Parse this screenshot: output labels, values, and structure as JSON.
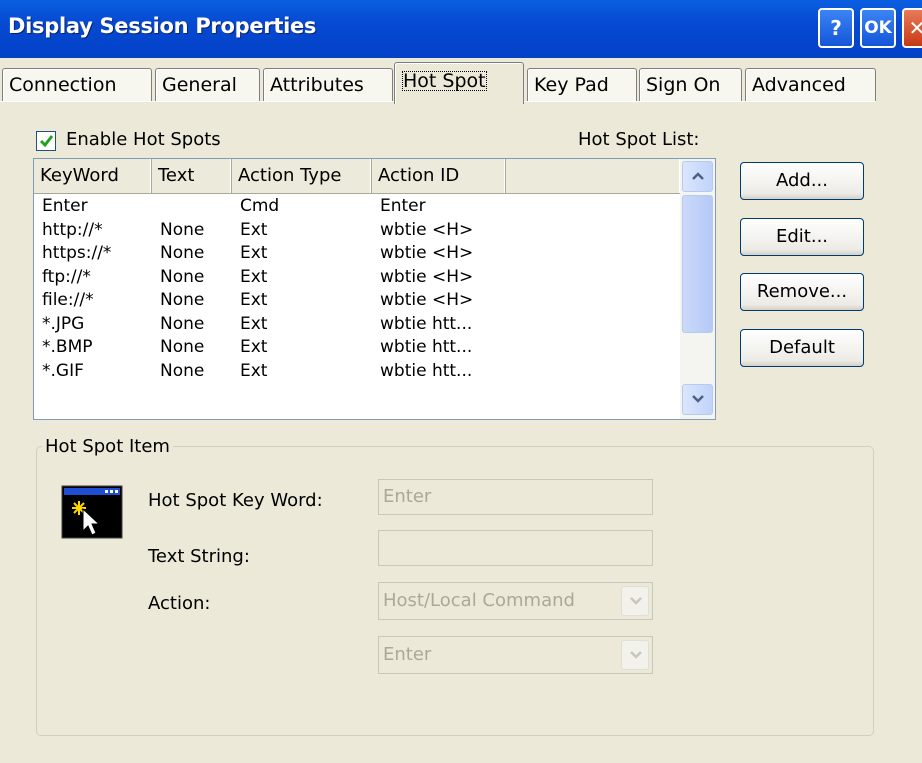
{
  "window": {
    "title": "Display Session Properties",
    "help_label": "?",
    "ok_label": "OK",
    "close_label": "✕"
  },
  "tabs": [
    {
      "label": "Connection"
    },
    {
      "label": "General"
    },
    {
      "label": "Attributes"
    },
    {
      "label": "Hot Spot",
      "active": true
    },
    {
      "label": "Key Pad"
    },
    {
      "label": "Sign On"
    },
    {
      "label": "Advanced"
    }
  ],
  "enable_hot_spots": {
    "label": "Enable Hot Spots",
    "checked": true
  },
  "hot_spot_list": {
    "label": "Hot Spot List:",
    "columns": [
      "KeyWord",
      "Text",
      "Action Type",
      "Action ID",
      ""
    ],
    "rows": [
      [
        "Enter",
        "",
        "Cmd",
        "Enter"
      ],
      [
        "http://*",
        "None",
        "Ext",
        "wbtie <H>"
      ],
      [
        "https://*",
        "None",
        "Ext",
        "wbtie <H>"
      ],
      [
        "ftp://*",
        "None",
        "Ext",
        "wbtie <H>"
      ],
      [
        "file://*",
        "None",
        "Ext",
        "wbtie <H>"
      ],
      [
        "*.JPG",
        "None",
        "Ext",
        "wbtie htt..."
      ],
      [
        "*.BMP",
        "None",
        "Ext",
        "wbtie htt..."
      ],
      [
        "*.GIF",
        "None",
        "Ext",
        "wbtie htt..."
      ]
    ]
  },
  "buttons": {
    "add": "Add...",
    "edit": "Edit...",
    "remove": "Remove...",
    "default": "Default"
  },
  "hot_spot_item": {
    "group_label": "Hot Spot Item",
    "key_word_label": "Hot Spot Key Word:",
    "key_word_value": "Enter",
    "text_string_label": "Text String:",
    "text_string_value": "",
    "action_label": "Action:",
    "action_value": "Host/Local Command",
    "action_id_value": "Enter"
  },
  "colors": {
    "titlebar": "#0649d2",
    "dialog_bg": "#ece9d8",
    "checkmark": "#21a121"
  }
}
